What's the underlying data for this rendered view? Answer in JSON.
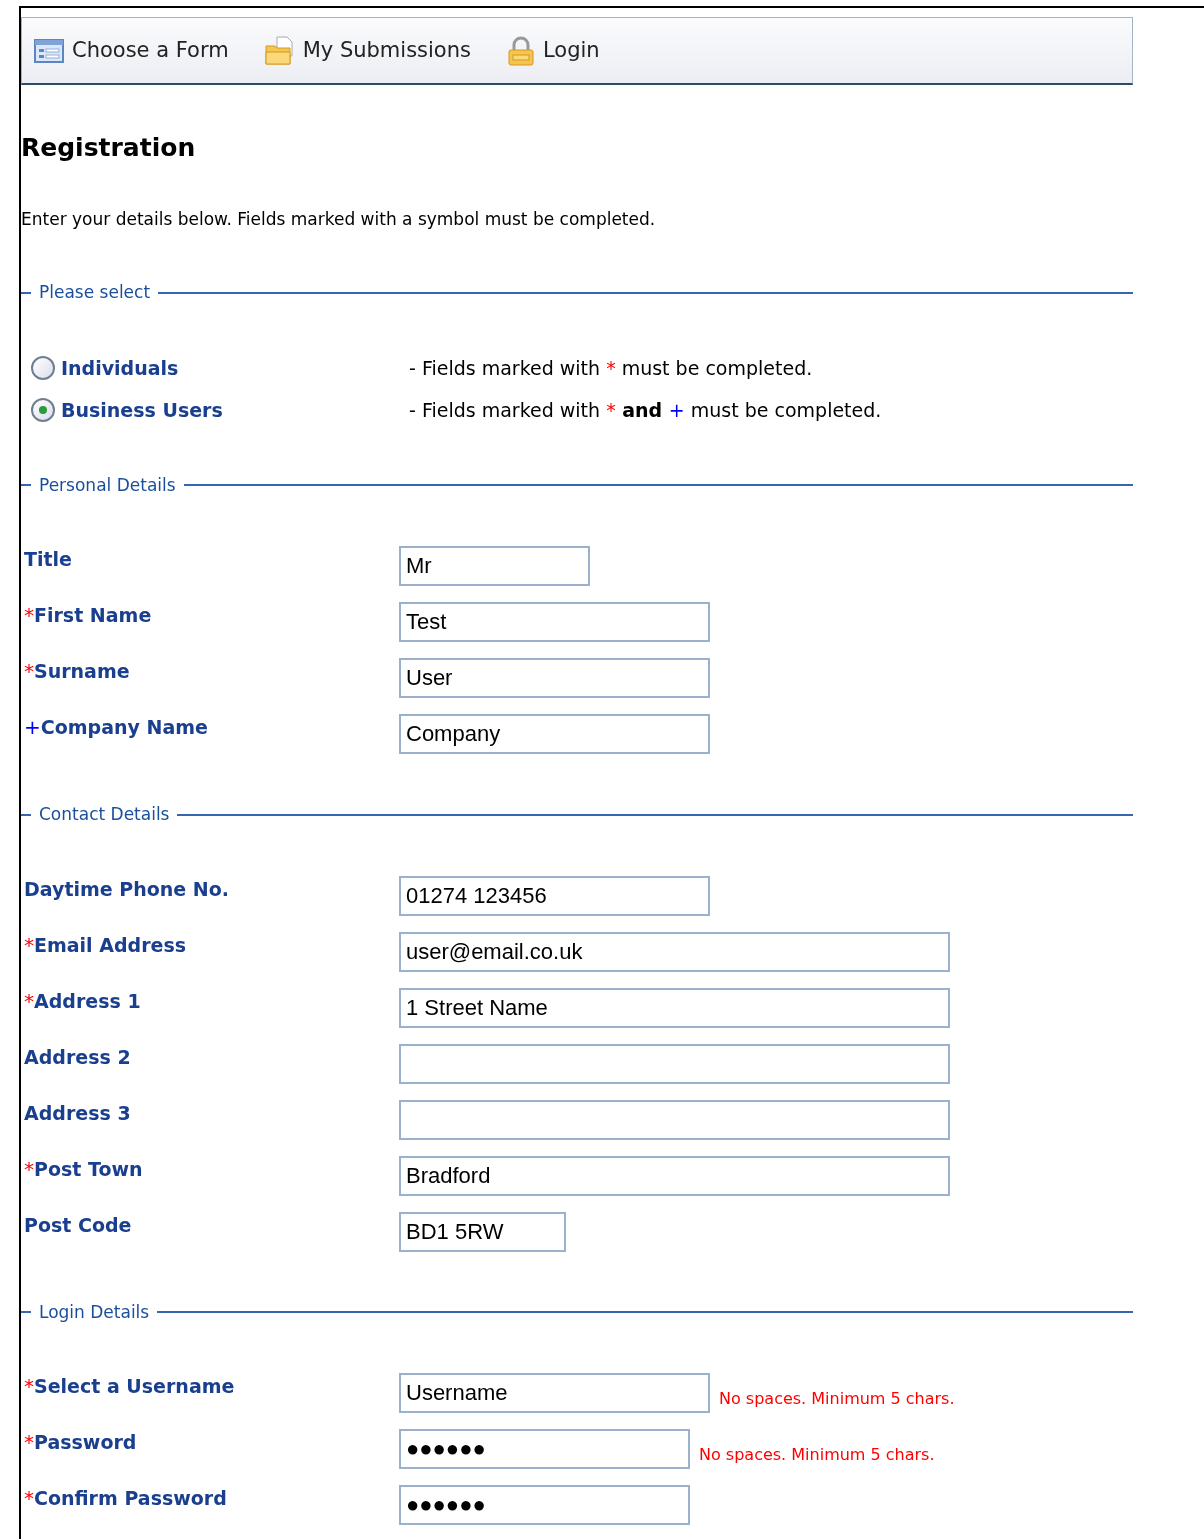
{
  "toolbar": [
    {
      "label": "Choose a Form"
    },
    {
      "label": "My Submissions"
    },
    {
      "label": "Login"
    }
  ],
  "heading": "Registration",
  "intro": "Enter your details below. Fields marked with a symbol must be completed.",
  "sections": [
    {
      "kind": "options",
      "legend": "Please select",
      "options": [
        {
          "label": "Individuals",
          "selected": false,
          "note": [
            {
              "kind": "text",
              "text": "- Fields marked with "
            },
            {
              "kind": "required",
              "text": "*"
            },
            {
              "kind": "text",
              "text": " must be completed."
            }
          ]
        },
        {
          "label": "Business Users",
          "selected": true,
          "note": [
            {
              "kind": "text",
              "text": "- Fields marked with "
            },
            {
              "kind": "required",
              "text": "*"
            },
            {
              "kind": "bold",
              "text": " and "
            },
            {
              "kind": "business",
              "text": "+"
            },
            {
              "kind": "text",
              "text": " must be completed."
            }
          ]
        }
      ]
    },
    {
      "kind": "fields",
      "legend": "Personal Details",
      "fields": [
        {
          "label": "Title",
          "value": "Mr"
        },
        {
          "label": "First Name",
          "marker": {
            "kind": "required",
            "text": "*"
          },
          "value": "Test"
        },
        {
          "label": "Surname",
          "marker": {
            "kind": "required",
            "text": "*"
          },
          "value": "User"
        },
        {
          "label": "Company Name",
          "marker": {
            "kind": "business",
            "text": "+"
          },
          "value": "Company"
        }
      ]
    },
    {
      "kind": "fields",
      "legend": "Contact Details",
      "fields": [
        {
          "label": "Daytime Phone No.",
          "value": "01274 123456"
        },
        {
          "label": "Email Address",
          "marker": {
            "kind": "required",
            "text": "*"
          },
          "value": "user@email.co.uk"
        },
        {
          "label": "Address 1",
          "marker": {
            "kind": "required",
            "text": "*"
          },
          "value": "1 Street Name"
        },
        {
          "label": "Address 2"
        },
        {
          "label": "Address 3"
        },
        {
          "label": "Post Town",
          "marker": {
            "kind": "required",
            "text": "*"
          },
          "value": "Bradford"
        },
        {
          "label": "Post Code",
          "value": "BD1 5RW"
        }
      ]
    },
    {
      "kind": "fields",
      "legend": "Login Details",
      "fields": [
        {
          "label": "Select a Username",
          "marker": {
            "kind": "required",
            "text": "*"
          },
          "value": "Username",
          "hint": "No spaces. Minimum 5 chars."
        },
        {
          "label": "Password",
          "marker": {
            "kind": "required",
            "text": "*"
          },
          "value": "●●●●●●",
          "hint": "No spaces. Minimum 5 chars."
        },
        {
          "label": "Confirm Password",
          "marker": {
            "kind": "required",
            "text": "*"
          },
          "value": "●●●●●●"
        }
      ]
    }
  ]
}
